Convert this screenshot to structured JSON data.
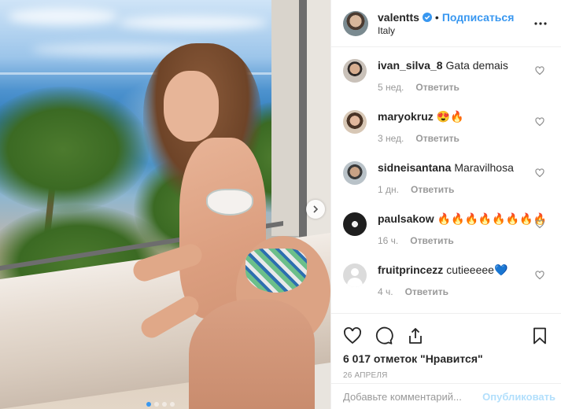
{
  "post": {
    "author": "valentts",
    "location": "Italy",
    "follow_label": "Подписаться",
    "separator": "•",
    "verified": true
  },
  "carousel": {
    "total": 4,
    "active": 0
  },
  "comments": [
    {
      "user": "ivan_silva_8",
      "text": "Gata demais",
      "time": "5 нед.",
      "reply": "Ответить"
    },
    {
      "user": "maryokruz",
      "text": "😍🔥",
      "time": "3 нед.",
      "reply": "Ответить"
    },
    {
      "user": "sidneisantana",
      "text": "Maravilhosa",
      "time": "1 дн.",
      "reply": "Ответить"
    },
    {
      "user": "paulsakow",
      "text": "🔥🔥🔥🔥🔥🔥🔥🔥",
      "time": "16 ч.",
      "reply": "Ответить"
    },
    {
      "user": "fruitprincezz",
      "text": "cutieeeee💙",
      "time": "4 ч.",
      "reply": "Ответить"
    }
  ],
  "likes_text": "6 017 отметок \"Нравится\"",
  "date": "26 АПРЕЛЯ",
  "add_comment": {
    "placeholder": "Добавьте комментарий...",
    "publish_label": "Опубликовать"
  },
  "icons": {
    "verified": "verified-badge-icon",
    "more": "more-options-icon",
    "like": "heart-icon",
    "comment": "comment-icon",
    "share": "share-icon",
    "save": "bookmark-icon",
    "next": "chevron-right-icon"
  },
  "colors": {
    "link": "#3897f0",
    "text": "#262626",
    "muted": "#999999",
    "publish_disabled": "#b2dffc"
  }
}
